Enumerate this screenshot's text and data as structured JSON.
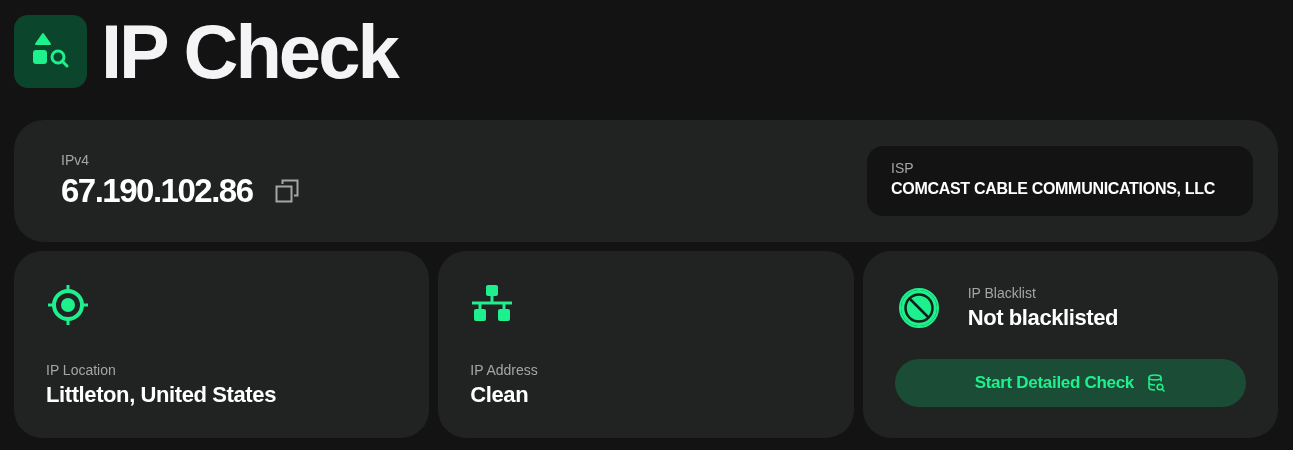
{
  "header": {
    "title": "IP Check"
  },
  "ip": {
    "label": "IPv4",
    "value": "67.190.102.86"
  },
  "isp": {
    "label": "ISP",
    "value": "COMCAST CABLE COMMUNICATIONS, LLC"
  },
  "cards": [
    {
      "kind": "location",
      "label": "IP Location",
      "value": "Littleton, United States"
    },
    {
      "kind": "address",
      "label": "IP Address",
      "value": "Clean"
    },
    {
      "kind": "blacklist",
      "label": "IP Blacklist",
      "value": "Not blacklisted",
      "button": "Start Detailed Check"
    }
  ]
}
